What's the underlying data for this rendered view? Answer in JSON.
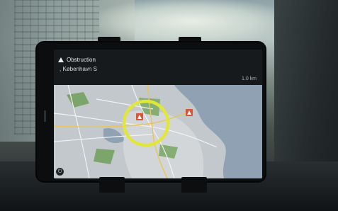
{
  "navigation": {
    "alert_title": "Obstruction",
    "location": ", København S",
    "distance": "1.0 km"
  },
  "icons": {
    "alert": "warning-triangle-icon",
    "incident_marker": "hazard-marker-icon",
    "settings": "power-icon"
  },
  "colors": {
    "highlight_ring": "#e1e63c",
    "incident": "#d9553a",
    "water": "#8fa1b3",
    "land": "#c9cdd1",
    "parks": "#7ca56c"
  }
}
